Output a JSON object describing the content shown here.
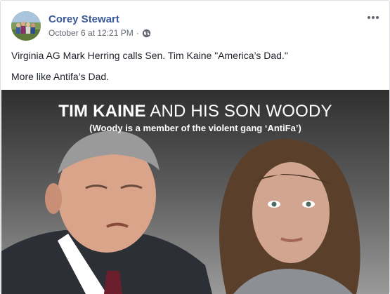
{
  "post": {
    "author": "Corey Stewart",
    "timestamp": "October 6 at 12:21 PM",
    "separator": "·",
    "privacy_icon": "globe-icon",
    "more_icon": "more-options-icon",
    "text_lines": [
      "Virginia AG Mark Herring calls Sen. Tim Kaine \"America’s Dad.\"",
      "More like Antifa’s Dad."
    ],
    "image": {
      "headline_bold": "TIM KAINE",
      "headline_light": " AND HIS SON WOODY",
      "subheadline": "(Woody is a member of the violent gang ‘AntiFa’)"
    }
  },
  "colors": {
    "author_link": "#385898",
    "meta_text": "#616770",
    "body_text": "#1d2129",
    "border": "#dddfe2"
  }
}
